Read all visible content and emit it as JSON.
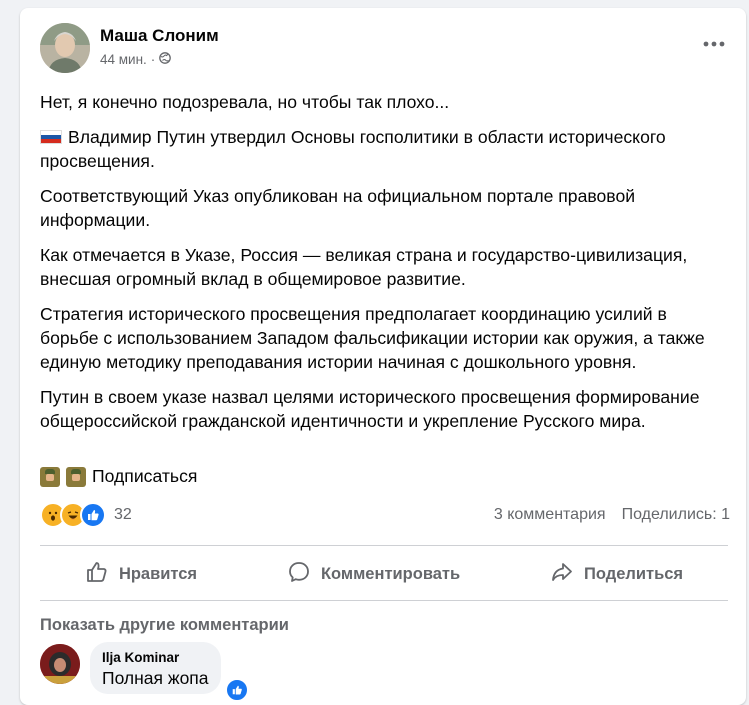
{
  "post": {
    "author": "Маша Слоним",
    "time": "44 мин.",
    "time_separator": "·",
    "paragraphs": [
      "Нет, я конечно подозревала, но чтобы так плохо...",
      "Владимир Путин утвердил Основы госполитики в области исторического просвещения.",
      "Соответствующий Указ опубликован на официальном портале правовой информации.",
      "Как отмечается в Указе, Россия — великая страна и государство-цивилизация, внесшая огромный вклад в общемировое развитие.",
      "Стратегия исторического просвещения предполагает координацию усилий в борьбе с использованием Западом фальсификации истории как оружия, а также единую методику преподавания истории начиная с дошкольного уровня.",
      "Путин в своем указе назвал целями исторического просвещения формирование общероссийской гражданской идентичности и укрепление Русского мира."
    ],
    "subscribe_label": "Подписаться"
  },
  "stats": {
    "reaction_count": "32",
    "comments": "3 комментария",
    "shares": "Поделились: 1",
    "reactions": [
      "wow",
      "haha",
      "like"
    ]
  },
  "actions": {
    "like": "Нравится",
    "comment": "Комментировать",
    "share": "Поделиться"
  },
  "comments": {
    "show_more": "Показать другие комментарии",
    "items": [
      {
        "author": "Ilja Kominar",
        "text": "Полная жопа"
      }
    ]
  },
  "colors": {
    "link_blue": "#1877f2",
    "secondary_text": "#65676b",
    "page_bg": "#f0f2f5"
  }
}
